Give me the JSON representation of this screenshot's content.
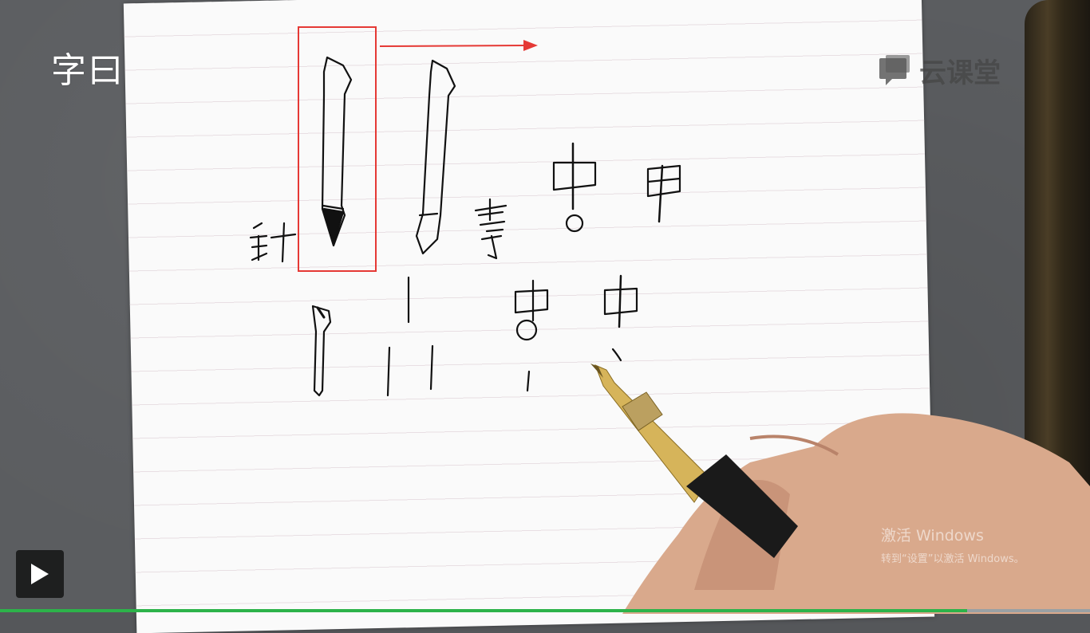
{
  "brand": {
    "left_logo": "字曰",
    "right_logo": "云课堂"
  },
  "handwriting": {
    "zhen": "针",
    "lu": "露",
    "zhong1": "中",
    "jia": "甲",
    "zhong2": "中",
    "zhong3": "中"
  },
  "player": {
    "play_icon": "play-icon",
    "progress": 0.887,
    "progress_color": "#2db34a"
  },
  "watermark": {
    "line1": "激活 Windows",
    "line2": "转到“设置”以激活 Windows。"
  },
  "annotation": {
    "box_color": "#e53935",
    "arrow_color": "#e53935"
  }
}
